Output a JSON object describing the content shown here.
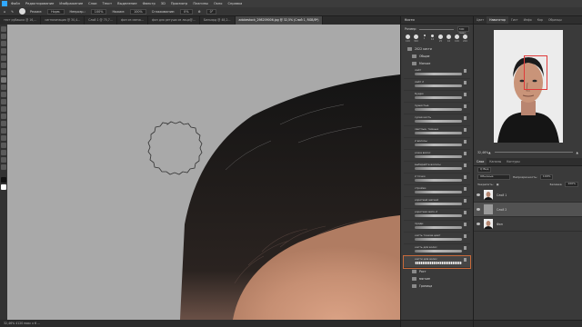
{
  "menu": [
    "Файл",
    "Редактирование",
    "Изображение",
    "Слои",
    "Текст",
    "Выделение",
    "Фильтр",
    "3D",
    "Просмотр",
    "Плагины",
    "Окно",
    "Справка"
  ],
  "options": {
    "mode_label": "Режим:",
    "mode_value": "Норм.",
    "opacity_label": "Непрозр.:",
    "opacity_value": "100%",
    "flow_label": "Нажим:",
    "flow_value": "100%",
    "smoothing_label": "Сглаживание:",
    "smoothing_value": "0%",
    "angle_value": "0°"
  },
  "tabs": [
    "тест рубашка @ 16,...",
    "сигнализация @ 30,4...",
    "Слой 1 @ 75,7...",
    "фон из свеча...",
    "фон для ретуши из лицо@...",
    "Бильярд @ 48,2...",
    "adobestock_298209006.jpg @ 32,5% (Слой 1, RGB/8*)"
  ],
  "active_tab_index": 6,
  "status": "32,46%     4120 пикс x 6 ...",
  "brushes_panel": {
    "title": "Кисти",
    "size_label": "Размер:",
    "size_value": "300 пикс.",
    "preset_sizes": [
      "100",
      "300",
      "1",
      "12",
      "25",
      "16",
      "100",
      "200"
    ],
    "folders": [
      "2022 кисти",
      "Общие",
      "Мягкие"
    ],
    "items": [
      "лайт",
      "лайт 2",
      "Кудри",
      "пушистые",
      "сухая кисть",
      "светлые, темные",
      "2 волосы",
      "кожа волос",
      "выбирайте волосы",
      "2 точки",
      "стройки",
      "короткий мягкий",
      "короткая мягк.2",
      "пряди",
      "кисть тонкие цвет",
      "кисть для волос",
      "кисти для волос"
    ],
    "selected_index": 16,
    "bottom_folders": [
      "Рост",
      "мягкие",
      "Граница"
    ]
  },
  "right_panel": {
    "tabs": [
      "Цвет",
      "Навигатор",
      "Гист",
      "Инфо",
      "Кор",
      "Образцы"
    ],
    "active_tab_index": 1,
    "zoom": "32,46%"
  },
  "layers_panel": {
    "tabs": [
      "Слои",
      "Каналы",
      "Контуры"
    ],
    "filter_label": "Q Вид",
    "blend_value": "Обычные",
    "opacity_label": "Непрозрачность:",
    "opacity_value": "100%",
    "lock_label": "Закрепить:",
    "fill_label": "Заливка:",
    "fill_value": "100%",
    "layers": [
      {
        "name": "Слой 1",
        "thumb": "face"
      },
      {
        "name": "Слой 2",
        "thumb": "gray"
      },
      {
        "name": "Фон",
        "thumb": "face"
      }
    ],
    "active_index": 1
  }
}
